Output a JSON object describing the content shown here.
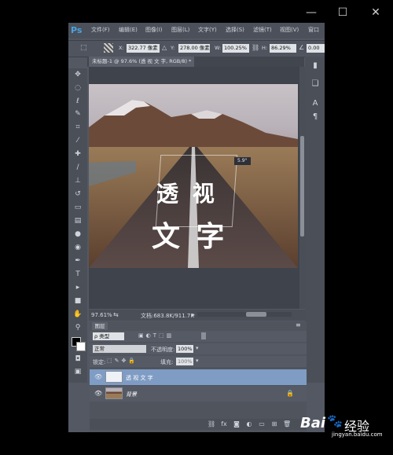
{
  "menubar": {
    "logo": "Ps",
    "items": [
      "文件(F)",
      "编辑(E)",
      "图像(I)",
      "图层(L)",
      "文字(Y)",
      "选择(S)",
      "滤镜(T)",
      "视图(V)",
      "窗口"
    ]
  },
  "options": {
    "x_label": "X:",
    "x_value": "322.77 像素",
    "y_label": "Y:",
    "y_value": "278.00 像素",
    "w_label": "W:",
    "w_value": "100.25%",
    "h_label": "H:",
    "h_value": "86.29%",
    "angle_value": "0.00"
  },
  "document": {
    "tab_title": "未标题-1 @ 97.6% (透 视 文 字, RGB/8) *",
    "canvas_text_line1": "透  视",
    "canvas_text_line2": "文  字",
    "angle_readout": "5.9°"
  },
  "status": {
    "zoom": "97.61%",
    "doc_info": "文档:683.8K/911.7K"
  },
  "layers_panel": {
    "tab_label": "图层",
    "filter_label": "ρ 类型",
    "blend_mode": "正常",
    "opacity_label": "不透明度:",
    "opacity_value": "100%",
    "lock_label": "锁定:",
    "fill_label": "填充:",
    "fill_value": "100%",
    "layers": [
      {
        "name": "透 视 文 字",
        "selected": true
      },
      {
        "name": "背景",
        "selected": false
      }
    ]
  },
  "watermark": {
    "brand": "Bai",
    "brand2": "经验",
    "url": "jingyan.baidu.com"
  },
  "colors": {
    "accent": "#4aa3df",
    "selected_layer": "#7f9cc4",
    "panel_bg": "#535863"
  }
}
